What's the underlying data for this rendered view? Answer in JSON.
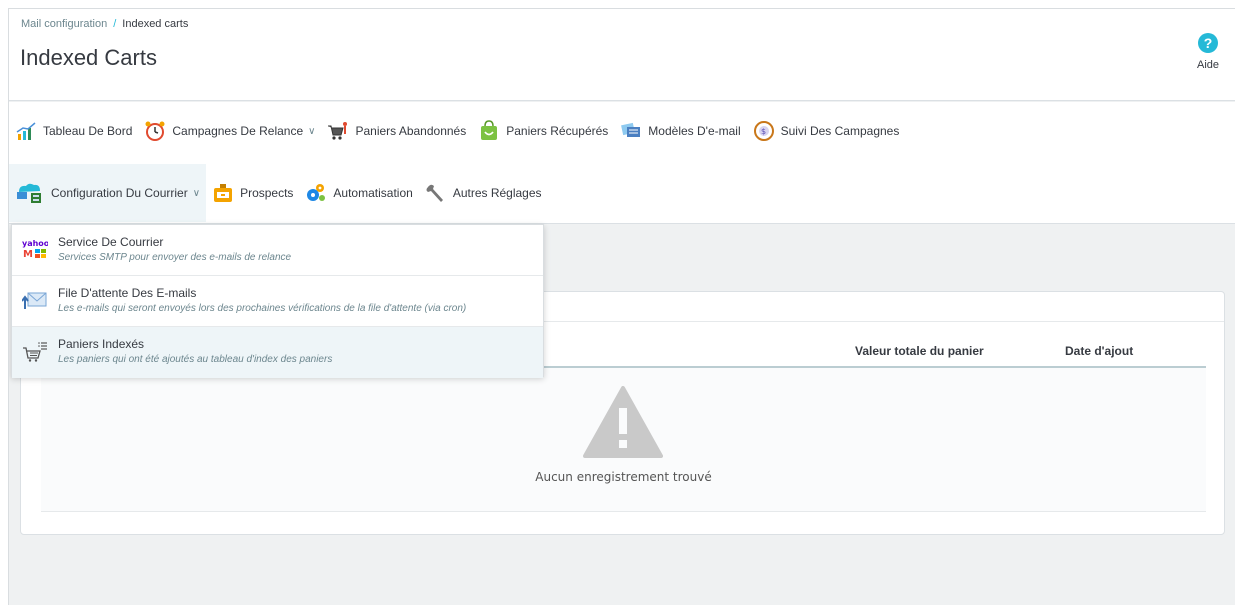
{
  "breadcrumb": {
    "parent": "Mail configuration",
    "separator": "/",
    "current": "Indexed carts"
  },
  "page_title": "Indexed Carts",
  "help": {
    "label": "Aide"
  },
  "nav": {
    "row1": [
      {
        "label": "Tableau De Bord",
        "icon": "chart-icon"
      },
      {
        "label": "Campagnes De Relance",
        "icon": "alarm-clock-icon",
        "has_dropdown": true
      },
      {
        "label": "Paniers Abandonnés",
        "icon": "shopping-cart-icon"
      },
      {
        "label": "Paniers Récupérés",
        "icon": "shopping-bag-icon"
      },
      {
        "label": "Modèles D'e-mail",
        "icon": "email-templates-icon"
      },
      {
        "label": "Suivi Des Campagnes",
        "icon": "tracking-icon"
      }
    ],
    "row2": [
      {
        "label": "Configuration Du Courrier",
        "icon": "mail-server-icon",
        "has_dropdown": true,
        "active": true
      },
      {
        "label": "Prospects",
        "icon": "prospects-icon"
      },
      {
        "label": "Automatisation",
        "icon": "gears-icon"
      },
      {
        "label": "Autres Réglages",
        "icon": "wrench-icon"
      }
    ]
  },
  "dropdown": {
    "items": [
      {
        "title": "Service De Courrier",
        "desc": "Services SMTP pour envoyer des e-mails de relance",
        "icon": "mail-services-icon"
      },
      {
        "title": "File D'attente Des E-mails",
        "desc": "Les e-mails qui seront envoyés lors des prochaines vérifications de la file d'attente (via cron)",
        "icon": "mail-queue-icon"
      },
      {
        "title": "Paniers Indexés",
        "desc": "Les paniers qui ont été ajoutés au tableau d'index des paniers",
        "icon": "indexed-cart-icon",
        "active": true
      }
    ]
  },
  "table": {
    "columns": [
      "Valeur totale du panier",
      "Date d'ajout"
    ],
    "empty_text": "Aucun enregistrement trouvé"
  },
  "colors": {
    "accent": "#25b9d7",
    "text": "#363a41",
    "muted": "#6c868e",
    "background": "#eff1f2"
  }
}
